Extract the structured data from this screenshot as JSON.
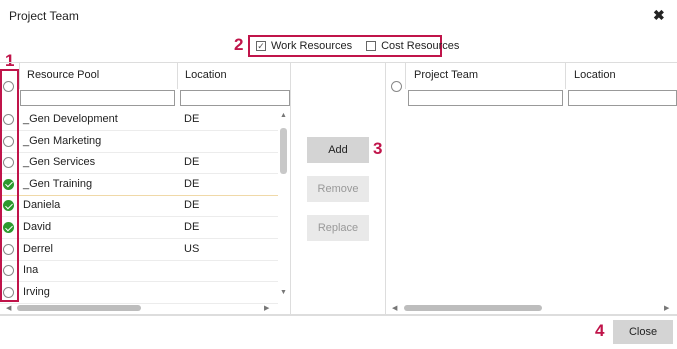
{
  "dialog": {
    "title": "Project Team",
    "close_glyph": "✖"
  },
  "callouts": {
    "one": "1",
    "two": "2",
    "three": "3",
    "four": "4"
  },
  "filters": {
    "work_label": "Work Resources",
    "work_checked": true,
    "cost_label": "Cost Resources",
    "cost_checked": false,
    "check_glyph": "✓"
  },
  "resource_pool": {
    "col_name": "Resource Pool",
    "col_location": "Location",
    "rows": [
      {
        "name": "_Gen Development",
        "location": "DE",
        "selected": false
      },
      {
        "name": "_Gen Marketing",
        "location": "",
        "selected": false
      },
      {
        "name": "_Gen Services",
        "location": "DE",
        "selected": false
      },
      {
        "name": "_Gen Training",
        "location": "DE",
        "selected": true
      },
      {
        "name": "Daniela",
        "location": "DE",
        "selected": true
      },
      {
        "name": "David",
        "location": "DE",
        "selected": true
      },
      {
        "name": "Derrel",
        "location": "US",
        "selected": false
      },
      {
        "name": "Ina",
        "location": "",
        "selected": false
      },
      {
        "name": "Irving",
        "location": "",
        "selected": false
      }
    ]
  },
  "actions": {
    "add": "Add",
    "remove": "Remove",
    "replace": "Replace"
  },
  "project_team": {
    "col_name": "Project Team",
    "col_location": "Location"
  },
  "footer": {
    "close": "Close"
  },
  "colors": {
    "accent": "#c0144a",
    "check": "#2d9a2d"
  }
}
